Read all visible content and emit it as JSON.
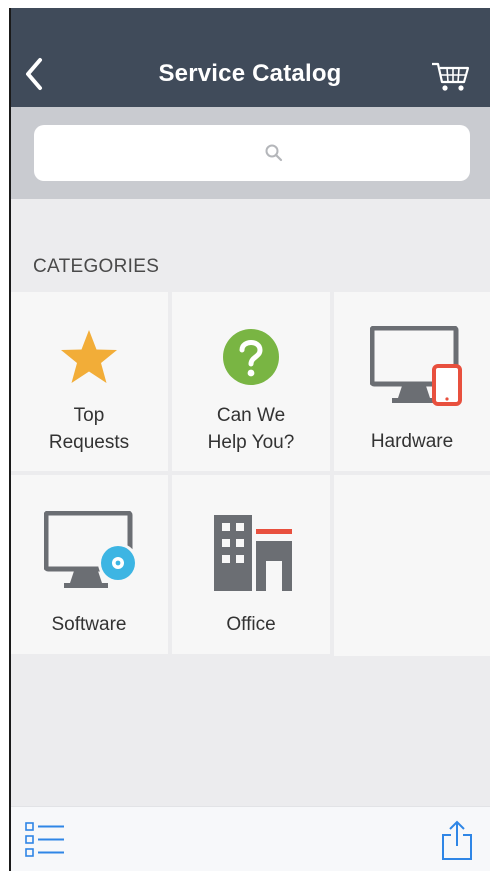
{
  "header": {
    "title": "Service Catalog"
  },
  "search": {
    "placeholder": ""
  },
  "categories": {
    "heading": "CATEGORIES",
    "items": [
      {
        "label_line1": "Top",
        "label_line2": "Requests",
        "icon": "star-icon"
      },
      {
        "label_line1": "Can We",
        "label_line2": "Help You?",
        "icon": "question-icon"
      },
      {
        "label": "Hardware",
        "icon": "monitor-phone-icon"
      },
      {
        "label": "Software",
        "icon": "monitor-disc-icon"
      },
      {
        "label": "Office",
        "icon": "building-icon"
      }
    ]
  },
  "colors": {
    "header_bg": "#404b5a",
    "search_band_bg": "#c9cbd0",
    "star": "#f2ad38",
    "question": "#79b543",
    "hardware_phone": "#e8503e",
    "software_disc": "#3db5e3",
    "office_accent": "#e8503e",
    "icon_gray": "#6b6e73",
    "bottom_icon_blue": "#2f86e6"
  },
  "bottom_bar": {
    "left_icon": "list-icon",
    "right_icon": "share-icon"
  }
}
